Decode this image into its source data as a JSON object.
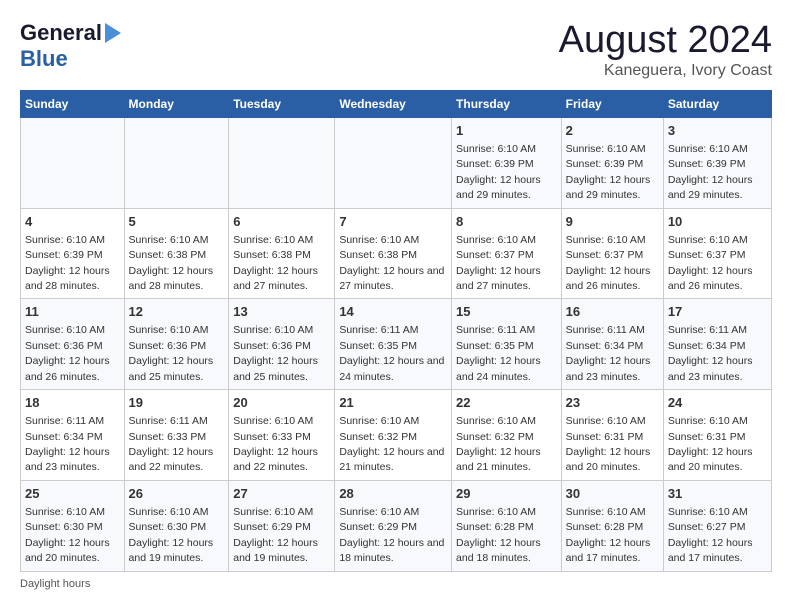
{
  "header": {
    "logo_line1": "General",
    "logo_line2": "Blue",
    "title": "August 2024",
    "subtitle": "Kaneguera, Ivory Coast"
  },
  "days_of_week": [
    "Sunday",
    "Monday",
    "Tuesday",
    "Wednesday",
    "Thursday",
    "Friday",
    "Saturday"
  ],
  "weeks": [
    [
      {
        "day": "",
        "info": ""
      },
      {
        "day": "",
        "info": ""
      },
      {
        "day": "",
        "info": ""
      },
      {
        "day": "",
        "info": ""
      },
      {
        "day": "1",
        "info": "Sunrise: 6:10 AM\nSunset: 6:39 PM\nDaylight: 12 hours and 29 minutes."
      },
      {
        "day": "2",
        "info": "Sunrise: 6:10 AM\nSunset: 6:39 PM\nDaylight: 12 hours and 29 minutes."
      },
      {
        "day": "3",
        "info": "Sunrise: 6:10 AM\nSunset: 6:39 PM\nDaylight: 12 hours and 29 minutes."
      }
    ],
    [
      {
        "day": "4",
        "info": "Sunrise: 6:10 AM\nSunset: 6:39 PM\nDaylight: 12 hours and 28 minutes."
      },
      {
        "day": "5",
        "info": "Sunrise: 6:10 AM\nSunset: 6:38 PM\nDaylight: 12 hours and 28 minutes."
      },
      {
        "day": "6",
        "info": "Sunrise: 6:10 AM\nSunset: 6:38 PM\nDaylight: 12 hours and 27 minutes."
      },
      {
        "day": "7",
        "info": "Sunrise: 6:10 AM\nSunset: 6:38 PM\nDaylight: 12 hours and 27 minutes."
      },
      {
        "day": "8",
        "info": "Sunrise: 6:10 AM\nSunset: 6:37 PM\nDaylight: 12 hours and 27 minutes."
      },
      {
        "day": "9",
        "info": "Sunrise: 6:10 AM\nSunset: 6:37 PM\nDaylight: 12 hours and 26 minutes."
      },
      {
        "day": "10",
        "info": "Sunrise: 6:10 AM\nSunset: 6:37 PM\nDaylight: 12 hours and 26 minutes."
      }
    ],
    [
      {
        "day": "11",
        "info": "Sunrise: 6:10 AM\nSunset: 6:36 PM\nDaylight: 12 hours and 26 minutes."
      },
      {
        "day": "12",
        "info": "Sunrise: 6:10 AM\nSunset: 6:36 PM\nDaylight: 12 hours and 25 minutes."
      },
      {
        "day": "13",
        "info": "Sunrise: 6:10 AM\nSunset: 6:36 PM\nDaylight: 12 hours and 25 minutes."
      },
      {
        "day": "14",
        "info": "Sunrise: 6:11 AM\nSunset: 6:35 PM\nDaylight: 12 hours and 24 minutes."
      },
      {
        "day": "15",
        "info": "Sunrise: 6:11 AM\nSunset: 6:35 PM\nDaylight: 12 hours and 24 minutes."
      },
      {
        "day": "16",
        "info": "Sunrise: 6:11 AM\nSunset: 6:34 PM\nDaylight: 12 hours and 23 minutes."
      },
      {
        "day": "17",
        "info": "Sunrise: 6:11 AM\nSunset: 6:34 PM\nDaylight: 12 hours and 23 minutes."
      }
    ],
    [
      {
        "day": "18",
        "info": "Sunrise: 6:11 AM\nSunset: 6:34 PM\nDaylight: 12 hours and 23 minutes."
      },
      {
        "day": "19",
        "info": "Sunrise: 6:11 AM\nSunset: 6:33 PM\nDaylight: 12 hours and 22 minutes."
      },
      {
        "day": "20",
        "info": "Sunrise: 6:10 AM\nSunset: 6:33 PM\nDaylight: 12 hours and 22 minutes."
      },
      {
        "day": "21",
        "info": "Sunrise: 6:10 AM\nSunset: 6:32 PM\nDaylight: 12 hours and 21 minutes."
      },
      {
        "day": "22",
        "info": "Sunrise: 6:10 AM\nSunset: 6:32 PM\nDaylight: 12 hours and 21 minutes."
      },
      {
        "day": "23",
        "info": "Sunrise: 6:10 AM\nSunset: 6:31 PM\nDaylight: 12 hours and 20 minutes."
      },
      {
        "day": "24",
        "info": "Sunrise: 6:10 AM\nSunset: 6:31 PM\nDaylight: 12 hours and 20 minutes."
      }
    ],
    [
      {
        "day": "25",
        "info": "Sunrise: 6:10 AM\nSunset: 6:30 PM\nDaylight: 12 hours and 20 minutes."
      },
      {
        "day": "26",
        "info": "Sunrise: 6:10 AM\nSunset: 6:30 PM\nDaylight: 12 hours and 19 minutes."
      },
      {
        "day": "27",
        "info": "Sunrise: 6:10 AM\nSunset: 6:29 PM\nDaylight: 12 hours and 19 minutes."
      },
      {
        "day": "28",
        "info": "Sunrise: 6:10 AM\nSunset: 6:29 PM\nDaylight: 12 hours and 18 minutes."
      },
      {
        "day": "29",
        "info": "Sunrise: 6:10 AM\nSunset: 6:28 PM\nDaylight: 12 hours and 18 minutes."
      },
      {
        "day": "30",
        "info": "Sunrise: 6:10 AM\nSunset: 6:28 PM\nDaylight: 12 hours and 17 minutes."
      },
      {
        "day": "31",
        "info": "Sunrise: 6:10 AM\nSunset: 6:27 PM\nDaylight: 12 hours and 17 minutes."
      }
    ]
  ],
  "footer": {
    "daylight_label": "Daylight hours"
  }
}
